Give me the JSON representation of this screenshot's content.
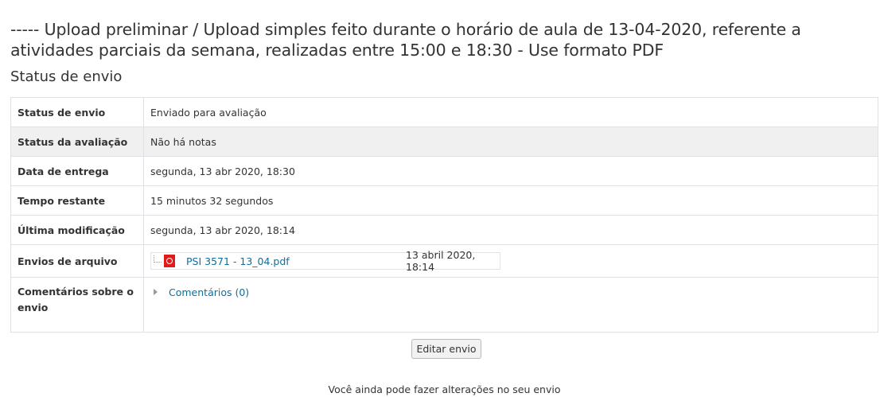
{
  "assignment": {
    "title": "----- Upload preliminar / Upload simples feito durante o horário de aula de 13-04-2020, referente a atividades parciais da semana, realizadas entre 15:00 e 18:30 - Use formato PDF"
  },
  "status_section": {
    "heading": "Status de envio",
    "rows": [
      {
        "label": "Status de envio",
        "value": "Enviado para avaliação"
      },
      {
        "label": "Status da avaliação",
        "value": "Não há notas"
      },
      {
        "label": "Data de entrega",
        "value": "segunda, 13 abr 2020, 18:30"
      },
      {
        "label": "Tempo restante",
        "value": "15 minutos 32 segundos"
      },
      {
        "label": "Última modificação",
        "value": "segunda, 13 abr 2020, 18:14"
      }
    ],
    "files": {
      "label": "Envios de arquivo",
      "file_name": "PSI 3571 - 13_04.pdf",
      "file_date": "13 abril 2020, 18:14",
      "file_icon": "pdf-icon"
    },
    "comments": {
      "label": "Comentários sobre o envio",
      "link": "Comentários (0)",
      "toggle_icon": "caret-right-icon"
    }
  },
  "actions": {
    "edit_button": "Editar envio",
    "note": "Você ainda pode fazer alterações no seu envio"
  }
}
